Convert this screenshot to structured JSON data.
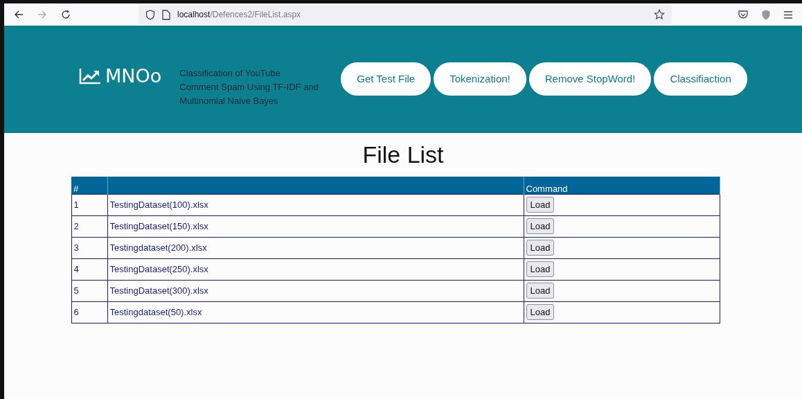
{
  "browser": {
    "url_host": "localhost",
    "url_path": "/Defences2/FileList.aspx"
  },
  "header": {
    "brand": "MNOo",
    "subtitle": "Classification of YouTube Comment Spam Using TF-IDF and Multinomial Naive Bayes",
    "nav": [
      "Get Test File",
      "Tokenization!",
      "Remove StopWord!",
      "Classifiaction"
    ]
  },
  "page_title": "File List",
  "table": {
    "columns": [
      "#",
      "",
      "Command"
    ],
    "rows": [
      {
        "index": "1",
        "file": "TestingDataset(100).xlsx",
        "action": "Load"
      },
      {
        "index": "2",
        "file": "TestingDataset(150).xlsx",
        "action": "Load"
      },
      {
        "index": "3",
        "file": "Testingdataset(200).xlsx",
        "action": "Load"
      },
      {
        "index": "4",
        "file": "TestingDataset(250).xlsx",
        "action": "Load"
      },
      {
        "index": "5",
        "file": "TestingDataset(300).xlsx",
        "action": "Load"
      },
      {
        "index": "6",
        "file": "Testingdataset(50).xlsx",
        "action": "Load"
      }
    ]
  }
}
